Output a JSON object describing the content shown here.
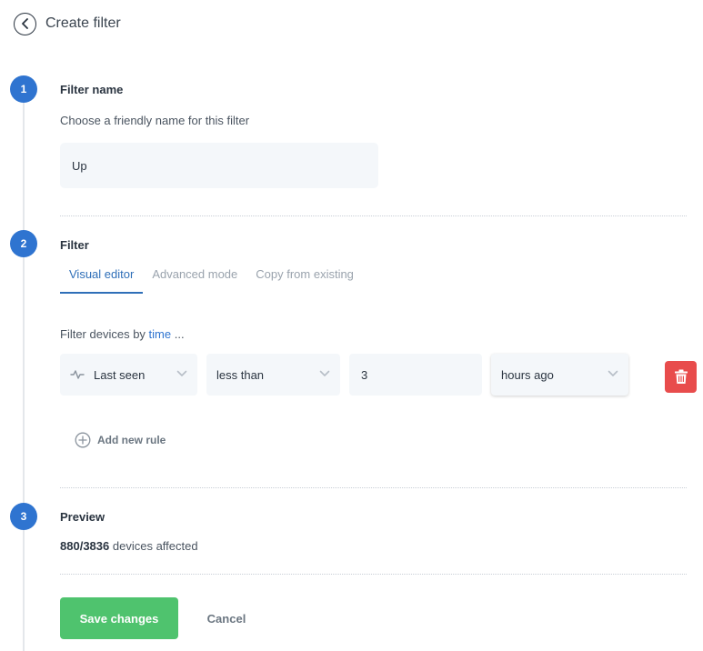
{
  "header": {
    "title": "Create filter",
    "back_icon": "chevron-left-icon"
  },
  "steps": [
    {
      "number": "1",
      "title": "Filter name"
    },
    {
      "number": "2",
      "title": "Filter"
    },
    {
      "number": "3",
      "title": "Preview"
    }
  ],
  "name_step": {
    "hint": "Choose a friendly name for this filter",
    "value": "Up"
  },
  "filter_step": {
    "tabs": [
      {
        "label": "Visual editor",
        "active": true
      },
      {
        "label": "Advanced mode",
        "active": false
      },
      {
        "label": "Copy from existing",
        "active": false
      }
    ],
    "filter_by_prefix": "Filter devices by",
    "filter_by_field": "time",
    "filter_by_suffix": "...",
    "rule": {
      "field": "Last seen",
      "field_icon": "activity-pulse-icon",
      "operator": "less than",
      "value": "3",
      "unit": "hours ago"
    },
    "add_rule_label": "Add new rule"
  },
  "preview_step": {
    "matched": "880",
    "total": "3836",
    "suffix": "devices affected"
  },
  "actions": {
    "save_label": "Save changes",
    "cancel_label": "Cancel"
  },
  "colors": {
    "accent": "#2f74d0",
    "save": "#4fc36e",
    "delete": "#e84c4c"
  }
}
